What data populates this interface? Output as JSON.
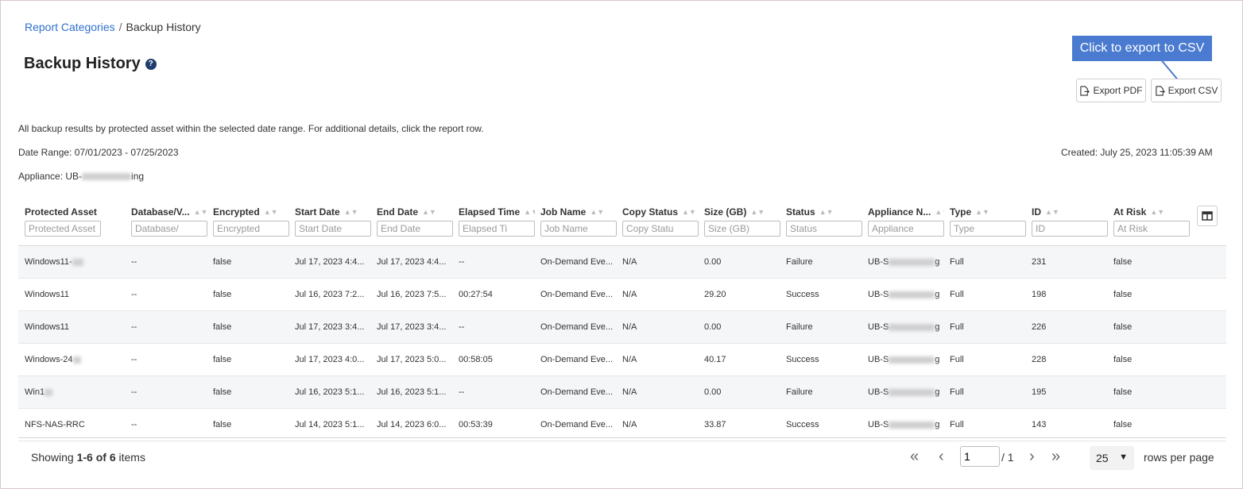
{
  "breadcrumb": {
    "parent": "Report Categories",
    "separator": "/",
    "current": "Backup History"
  },
  "page_title": "Backup History",
  "help_icon": "question-circle-icon",
  "callout": "Click to export to CSV",
  "buttons": {
    "export_pdf": "Export PDF",
    "export_csv": "Export CSV"
  },
  "description": "All backup results by protected asset within the selected date range. For additional details, click the report row.",
  "date_range": "Date Range: 07/01/2023 - 07/25/2023",
  "created": "Created: July 25, 2023 11:05:39 AM",
  "appliance": {
    "prefix": "Appliance: UB-",
    "suffix": "ing"
  },
  "columns": [
    {
      "label": "Protected Asset",
      "placeholder": "Protected Asset",
      "sorted": true
    },
    {
      "label": "Database/V...",
      "placeholder": "Database/"
    },
    {
      "label": "Encrypted",
      "placeholder": "Encrypted"
    },
    {
      "label": "Start Date",
      "placeholder": "Start Date"
    },
    {
      "label": "End Date",
      "placeholder": "End Date"
    },
    {
      "label": "Elapsed Time",
      "placeholder": "Elapsed Ti"
    },
    {
      "label": "Job Name",
      "placeholder": "Job Name"
    },
    {
      "label": "Copy Status",
      "placeholder": "Copy Statu"
    },
    {
      "label": "Size (GB)",
      "placeholder": "Size (GB)"
    },
    {
      "label": "Status",
      "placeholder": "Status"
    },
    {
      "label": "Appliance N...",
      "placeholder": "Appliance"
    },
    {
      "label": "Type",
      "placeholder": "Type"
    },
    {
      "label": "ID",
      "placeholder": "ID"
    },
    {
      "label": "At Risk",
      "placeholder": "At Risk"
    }
  ],
  "rows": [
    [
      "Windows11-",
      "--",
      "false",
      "Jul 17, 2023 4:4...",
      "Jul 17, 2023 4:4...",
      "--",
      "On-Demand Eve...",
      "N/A",
      "0.00",
      "Failure",
      "UB-S",
      "Full",
      "231",
      "false"
    ],
    [
      "Windows11",
      "--",
      "false",
      "Jul 16, 2023 7:2...",
      "Jul 16, 2023 7:5...",
      "00:27:54",
      "On-Demand Eve...",
      "N/A",
      "29.20",
      "Success",
      "UB-S",
      "Full",
      "198",
      "false"
    ],
    [
      "Windows11",
      "--",
      "false",
      "Jul 17, 2023 3:4...",
      "Jul 17, 2023 3:4...",
      "--",
      "On-Demand Eve...",
      "N/A",
      "0.00",
      "Failure",
      "UB-S",
      "Full",
      "226",
      "false"
    ],
    [
      "Windows-24",
      "--",
      "false",
      "Jul 17, 2023 4:0...",
      "Jul 17, 2023 5:0...",
      "00:58:05",
      "On-Demand Eve...",
      "N/A",
      "40.17",
      "Success",
      "UB-S",
      "Full",
      "228",
      "false"
    ],
    [
      "Win1",
      "--",
      "false",
      "Jul 16, 2023 5:1...",
      "Jul 16, 2023 5:1...",
      "--",
      "On-Demand Eve...",
      "N/A",
      "0.00",
      "Failure",
      "UB-S",
      "Full",
      "195",
      "false"
    ],
    [
      "NFS-NAS-RRC",
      "--",
      "false",
      "Jul 14, 2023 5:1...",
      "Jul 14, 2023 6:0...",
      "00:53:39",
      "On-Demand Eve...",
      "N/A",
      "33.87",
      "Success",
      "UB-S",
      "Full",
      "143",
      "false"
    ]
  ],
  "appliance_cell_suffix": "g",
  "pagination": {
    "showing_prefix": "Showing ",
    "showing_range": "1-6 of 6",
    "showing_suffix": " items",
    "current_page": "1",
    "total_pages": "/ 1",
    "rows_per_page": "25",
    "rows_per_page_label": "rows per page"
  }
}
